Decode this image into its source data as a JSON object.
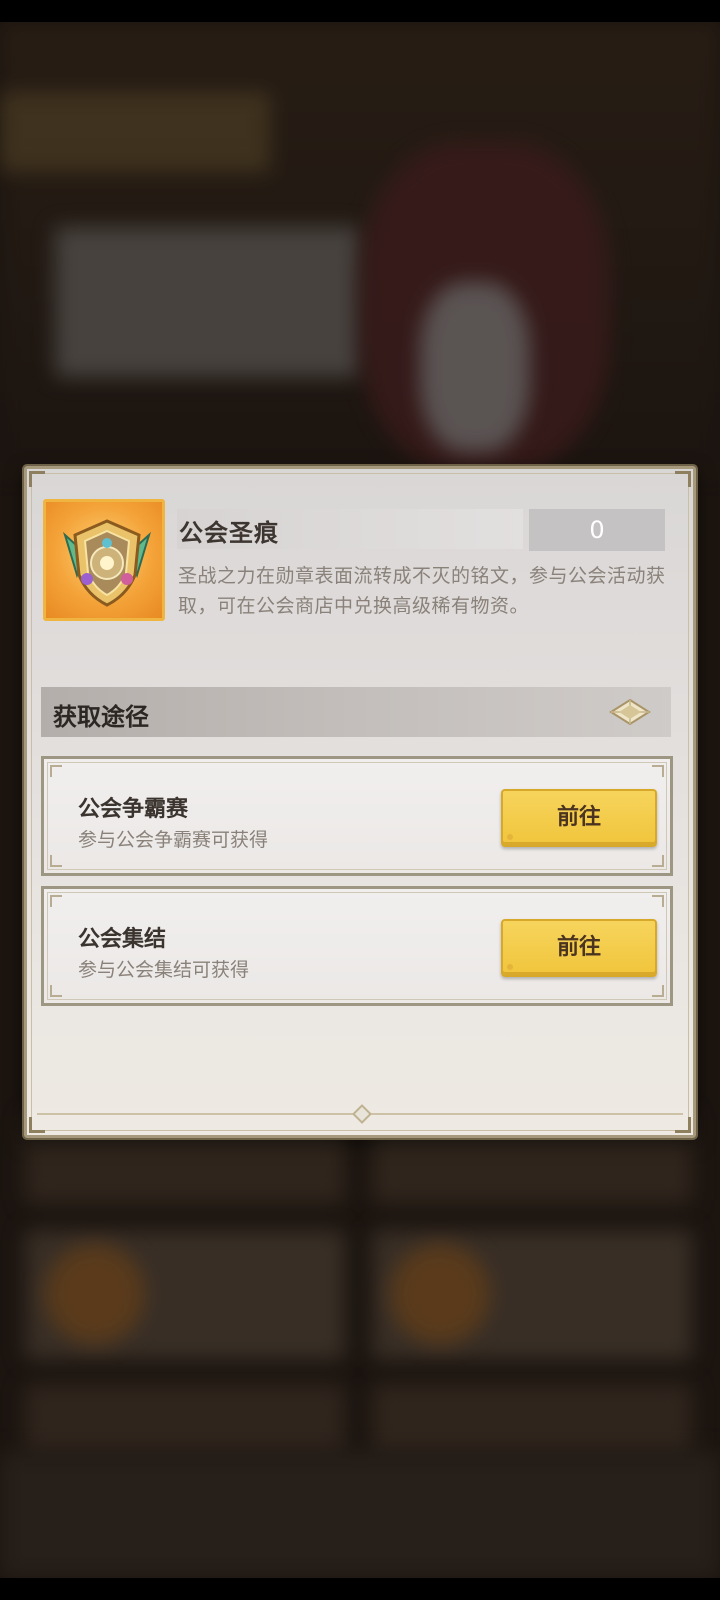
{
  "item": {
    "name": "公会圣痕",
    "count": "0",
    "description": "圣战之力在勋章表面流转成不灭的铭文，参与公会活动获取，可在公会商店中兑换高级稀有物资。",
    "icon": "guild-emblem-icon"
  },
  "sources_section": {
    "title": "获取途径",
    "toggle_icon": "diamond-icon"
  },
  "sources": [
    {
      "title": "公会争霸赛",
      "desc": "参与公会争霸赛可获得",
      "button": "前往"
    },
    {
      "title": "公会集结",
      "desc": "参与公会集结可获得",
      "button": "前往"
    }
  ],
  "colors": {
    "accent_button": "#f1c53c",
    "icon_frame": "#f0b440",
    "dialog_border": "#a7997c"
  }
}
